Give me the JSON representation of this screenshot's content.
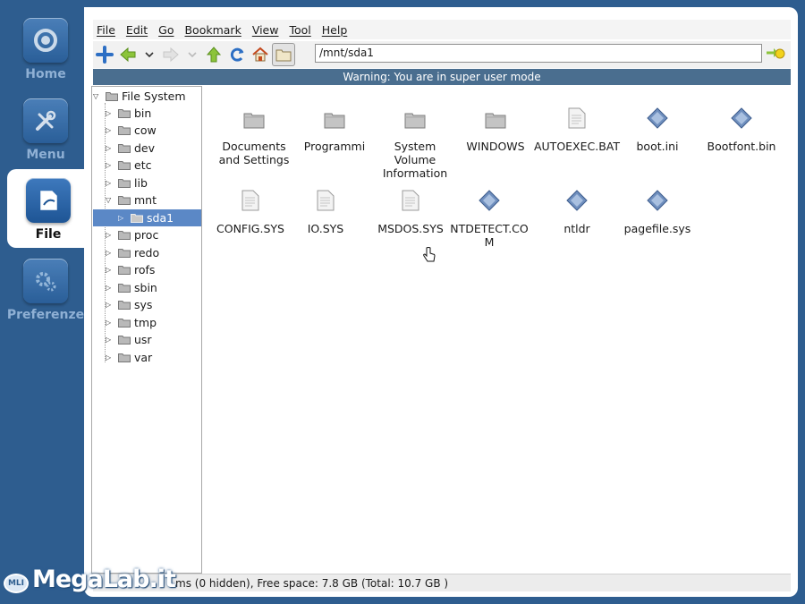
{
  "dock": {
    "items": [
      {
        "label": "Home",
        "icon": "home-icon"
      },
      {
        "label": "Menu",
        "icon": "tools-icon"
      },
      {
        "label": "File",
        "icon": "file-icon",
        "active": true
      },
      {
        "label": "Preferenze",
        "icon": "gear-icon"
      }
    ]
  },
  "menubar": [
    "File",
    "Edit",
    "Go",
    "Bookmark",
    "View",
    "Tool",
    "Help"
  ],
  "toolbar": {
    "address": "/mnt/sda1",
    "icons": [
      "new-tab-icon",
      "back-icon",
      "back-history-icon",
      "forward-icon",
      "forward-history-icon",
      "up-icon",
      "reload-icon",
      "home-icon",
      "folder-view-icon",
      "go-icon"
    ]
  },
  "warning": "Warning: You are in super user mode",
  "tree": {
    "root": "File System",
    "items": [
      "bin",
      "cow",
      "dev",
      "etc",
      "lib",
      "mnt",
      "sda1",
      "proc",
      "redo",
      "rofs",
      "sbin",
      "sys",
      "tmp",
      "usr",
      "var"
    ],
    "selected": "sda1"
  },
  "files": [
    {
      "name": "Documents and Settings",
      "type": "folder"
    },
    {
      "name": "Programmi",
      "type": "folder"
    },
    {
      "name": "System Volume Information",
      "type": "folder"
    },
    {
      "name": "WINDOWS",
      "type": "folder"
    },
    {
      "name": "AUTOEXEC.BAT",
      "type": "text"
    },
    {
      "name": "boot.ini",
      "type": "binary"
    },
    {
      "name": "Bootfont.bin",
      "type": "binary"
    },
    {
      "name": "CONFIG.SYS",
      "type": "text"
    },
    {
      "name": "IO.SYS",
      "type": "text"
    },
    {
      "name": "MSDOS.SYS",
      "type": "text"
    },
    {
      "name": "NTDETECT.COM",
      "type": "binary"
    },
    {
      "name": "ntldr",
      "type": "binary"
    },
    {
      "name": "pagefile.sys",
      "type": "binary"
    }
  ],
  "status": "ms (0 hidden), Free space: 7.8 GB (Total: 10.7 GB )",
  "watermark": {
    "badge": "MLI",
    "text": "MegaLab.it"
  }
}
